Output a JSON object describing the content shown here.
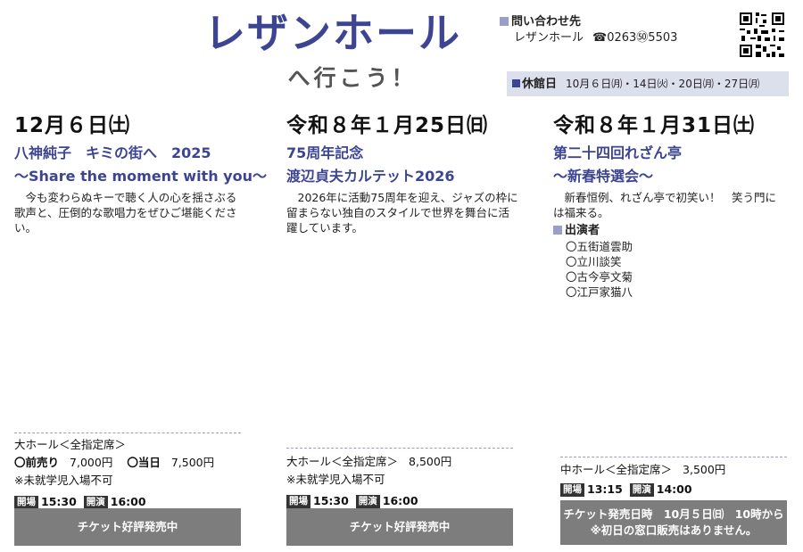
{
  "header": {
    "title": "レザンホール",
    "subtitle": "へ行こう！",
    "contact_label": "問い合わせ先",
    "contact_name": "レザンホール",
    "contact_phone": "☎0263㊿5503",
    "closed_label": "休館日",
    "closed_dates": "10月６日㈪・14日㈫・20日㈪・27日㈪"
  },
  "events": [
    {
      "date": "12月６日㈯",
      "title1": "八神純子　キミの街へ　2025",
      "title2": "〜Share the moment with you〜",
      "description": "今も変わらぬキーで聴く人の心を揺さぶる歌声と、圧倒的な歌唱力をぜひご堪能ください。",
      "hall": "大ホール＜全指定席＞",
      "presale_label": "前売り",
      "presale_price": "7,000円",
      "dayof_label": "当日",
      "dayof_price": "7,500円",
      "note": "※未就学児入場不可",
      "open_label": "開場",
      "open_time": "15:30",
      "start_label": "開演",
      "start_time": "16:00",
      "banner": "チケット好評発売中"
    },
    {
      "date": "令和８年１月25日㈰",
      "title1": "75周年記念",
      "title2": "渡辺貞夫カルテット2026",
      "description": "2026年に活動75周年を迎え、ジャズの枠に留まらない独自のスタイルで世界を舞台に活躍しています。",
      "hall": "大ホール＜全指定席＞",
      "price": "8,500円",
      "note": "※未就学児入場不可",
      "open_label": "開場",
      "open_time": "15:30",
      "start_label": "開演",
      "start_time": "16:00",
      "banner": "チケット好評発売中"
    },
    {
      "date": "令和８年１月31日㈯",
      "title1": "第二十四回れざん亭",
      "title2": "〜新春特選会〜",
      "description": "新春恒例、れざん亭で初笑い！　笑う門には福来る。",
      "performers_label": "出演者",
      "performers": [
        "五街道雲助",
        "立川談笑",
        "古今亭文菊",
        "江戸家猫八"
      ],
      "hall": "中ホール＜全指定席＞",
      "price": "3,500円",
      "open_label": "開場",
      "open_time": "13:15",
      "start_label": "開演",
      "start_time": "14:00",
      "banner_line1": "チケット発売日時　10月５日㈰　10時から",
      "banner_line2": "※初日の窓口販売はありません。"
    }
  ],
  "colors": {
    "accent": "#3d4593",
    "light_accent": "#9a9ec8",
    "banner": "#7d7d7d",
    "closed_bg": "#dcdfec"
  },
  "icons": [
    "qr-code-icon",
    "telephone-icon"
  ]
}
